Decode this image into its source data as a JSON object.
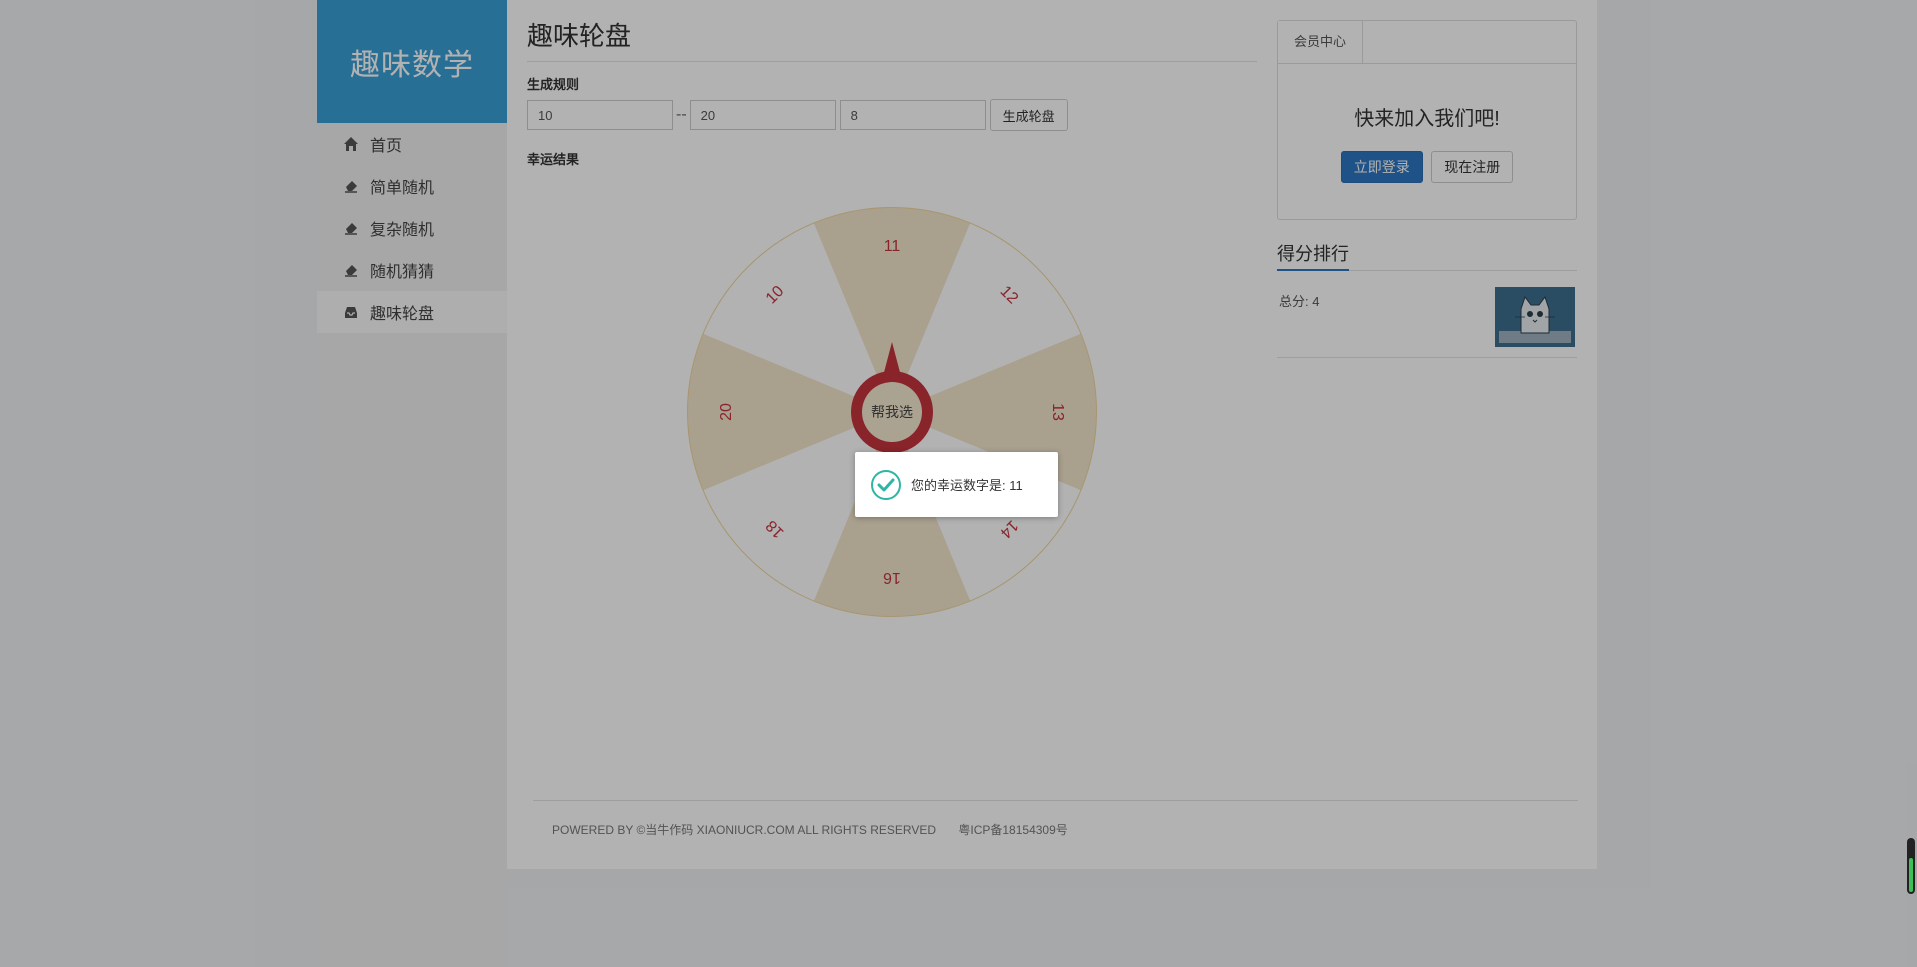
{
  "sidebar": {
    "logo": "趣味数学",
    "items": [
      {
        "label": "首页",
        "icon": "home-icon"
      },
      {
        "label": "简单随机",
        "icon": "eraser-icon"
      },
      {
        "label": "复杂随机",
        "icon": "eraser-icon"
      },
      {
        "label": "随机猜猜",
        "icon": "eraser-icon"
      },
      {
        "label": "趣味轮盘",
        "icon": "inbox-icon",
        "active": true
      }
    ]
  },
  "main": {
    "title": "趣味轮盘",
    "rule_label": "生成规则",
    "min_value": "10",
    "dash": "--",
    "max_value": "20",
    "count_value": "8",
    "generate_button": "生成轮盘",
    "result_label": "幸运结果",
    "wheel": {
      "numbers": [
        "11",
        "12",
        "13",
        "14",
        "16",
        "18",
        "20",
        "10"
      ],
      "center_button": "帮我选",
      "accent": "#c5343e"
    }
  },
  "member": {
    "tab": "会员中心",
    "join_text": "快来加入我们吧!",
    "login_button": "立即登录",
    "register_button": "现在注册"
  },
  "ranking": {
    "title": "得分排行",
    "score_text": "总分: 4"
  },
  "footer": {
    "powered": "POWERED BY ©当牛作码 XIAONIUCR.COM ALL RIGHTS RESERVED",
    "icp": "粤ICP备18154309号"
  },
  "toast": {
    "message": "您的幸运数字是: 11"
  },
  "colors": {
    "brand": "#3a9fd6",
    "primary": "#2d78c3",
    "wheel_shade": "#f3e6cc",
    "wheel_border": "#f0d7a0",
    "success": "#2fb5a3"
  }
}
